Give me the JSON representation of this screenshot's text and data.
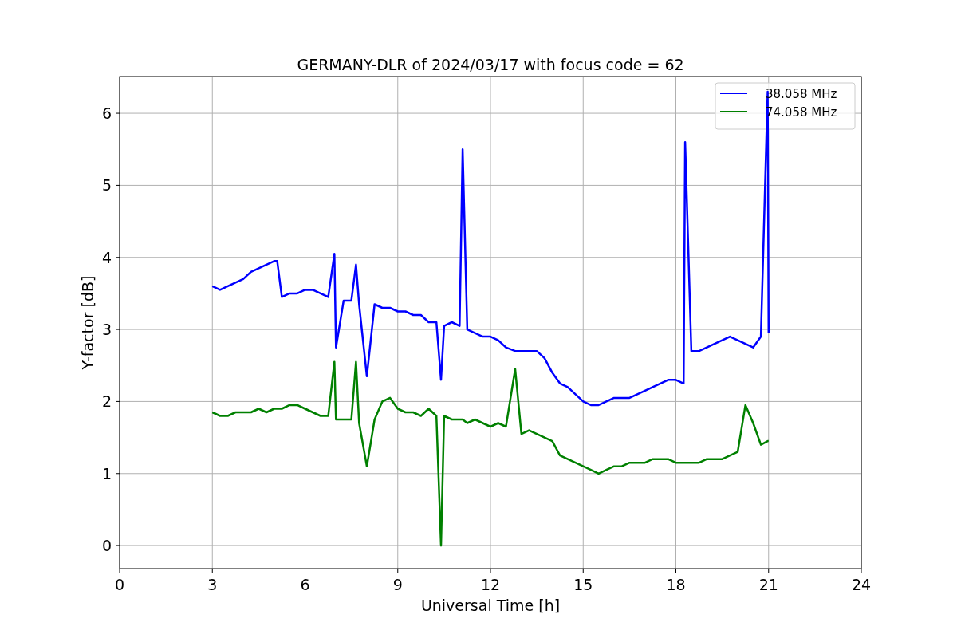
{
  "chart_data": {
    "type": "line",
    "title": "GERMANY-DLR of 2024/03/17 with focus code = 62",
    "xlabel": "Universal Time [h]",
    "ylabel": "Y-factor [dB]",
    "x": [
      3,
      3.25,
      3.5,
      3.75,
      4,
      4.25,
      4.5,
      4.75,
      5,
      5.1,
      5.25,
      5.5,
      5.75,
      6,
      6.25,
      6.5,
      6.75,
      6.95,
      7,
      7.25,
      7.5,
      7.65,
      7.75,
      8,
      8.25,
      8.5,
      8.75,
      9,
      9.25,
      9.5,
      9.75,
      10,
      10.25,
      10.4,
      10.5,
      10.75,
      11,
      11.1,
      11.25,
      11.5,
      11.75,
      12,
      12.25,
      12.5,
      12.8,
      13,
      13.25,
      13.5,
      13.75,
      14,
      14.25,
      14.5,
      14.75,
      15,
      15.25,
      15.5,
      15.75,
      16,
      16.25,
      16.5,
      16.75,
      17,
      17.25,
      17.5,
      17.75,
      18,
      18.25,
      18.3,
      18.5,
      18.75,
      19,
      19.25,
      19.5,
      19.75,
      20,
      20.25,
      20.5,
      20.75,
      20.97,
      21
    ],
    "series": [
      {
        "name": "38.058 MHz",
        "color": "#0000ff",
        "values": [
          3.6,
          3.55,
          3.6,
          3.65,
          3.7,
          3.8,
          3.85,
          3.9,
          3.95,
          3.95,
          3.45,
          3.5,
          3.5,
          3.55,
          3.55,
          3.5,
          3.45,
          4.05,
          2.75,
          3.4,
          3.4,
          3.9,
          3.35,
          2.35,
          3.35,
          3.3,
          3.3,
          3.25,
          3.25,
          3.2,
          3.2,
          3.1,
          3.1,
          2.3,
          3.05,
          3.1,
          3.05,
          5.5,
          3.0,
          2.95,
          2.9,
          2.9,
          2.85,
          2.75,
          2.7,
          2.7,
          2.7,
          2.7,
          2.6,
          2.4,
          2.25,
          2.2,
          2.1,
          2.0,
          1.95,
          1.95,
          2.0,
          2.05,
          2.05,
          2.05,
          2.1,
          2.15,
          2.2,
          2.25,
          2.3,
          2.3,
          2.25,
          5.6,
          2.7,
          2.7,
          2.75,
          2.8,
          2.85,
          2.9,
          2.85,
          2.8,
          2.75,
          2.9,
          6.3,
          2.95
        ]
      },
      {
        "name": "74.058 MHz",
        "color": "#008000",
        "values": [
          1.85,
          1.8,
          1.8,
          1.85,
          1.85,
          1.85,
          1.9,
          1.85,
          1.9,
          1.9,
          1.9,
          1.95,
          1.95,
          1.9,
          1.85,
          1.8,
          1.8,
          2.55,
          1.75,
          1.75,
          1.75,
          2.55,
          1.7,
          1.1,
          1.75,
          2.0,
          2.05,
          1.9,
          1.85,
          1.85,
          1.8,
          1.9,
          1.8,
          0.0,
          1.8,
          1.75,
          1.75,
          1.75,
          1.7,
          1.75,
          1.7,
          1.65,
          1.7,
          1.65,
          2.45,
          1.55,
          1.6,
          1.55,
          1.5,
          1.45,
          1.25,
          1.2,
          1.15,
          1.1,
          1.05,
          1.0,
          1.05,
          1.1,
          1.1,
          1.15,
          1.15,
          1.15,
          1.2,
          1.2,
          1.2,
          1.15,
          1.15,
          1.15,
          1.15,
          1.15,
          1.2,
          1.2,
          1.2,
          1.25,
          1.3,
          1.95,
          1.7,
          1.4,
          1.45,
          1.45
        ]
      }
    ],
    "grid": true,
    "legend": true,
    "xlim": [
      0,
      24
    ],
    "ylim": [
      -0.32,
      6.51
    ],
    "xticks": [
      0,
      3,
      6,
      9,
      12,
      15,
      18,
      21,
      24
    ],
    "yticks": [
      0,
      1,
      2,
      3,
      4,
      5,
      6
    ]
  }
}
